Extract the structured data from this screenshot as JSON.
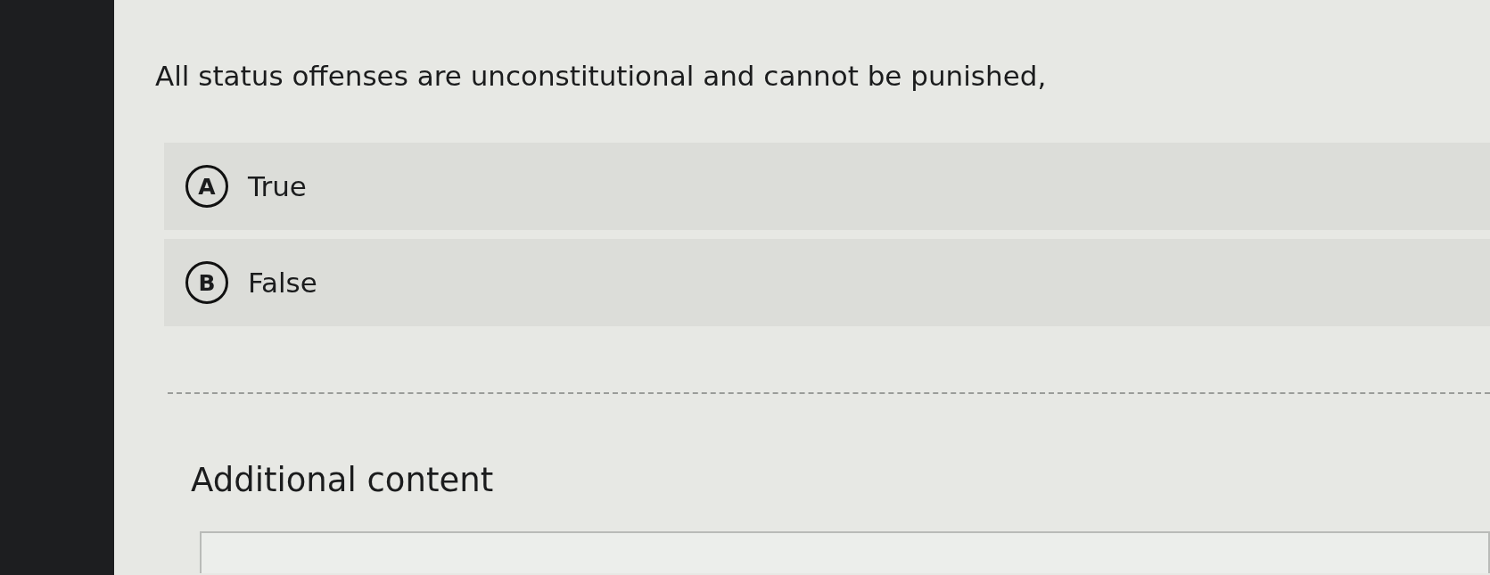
{
  "question": {
    "text": "All status offenses are unconstitutional and cannot be punished,"
  },
  "options": [
    {
      "letter": "A",
      "label": "True",
      "selected": false
    },
    {
      "letter": "B",
      "label": "False",
      "selected": false
    }
  ],
  "additional": {
    "heading": "Additional content"
  }
}
